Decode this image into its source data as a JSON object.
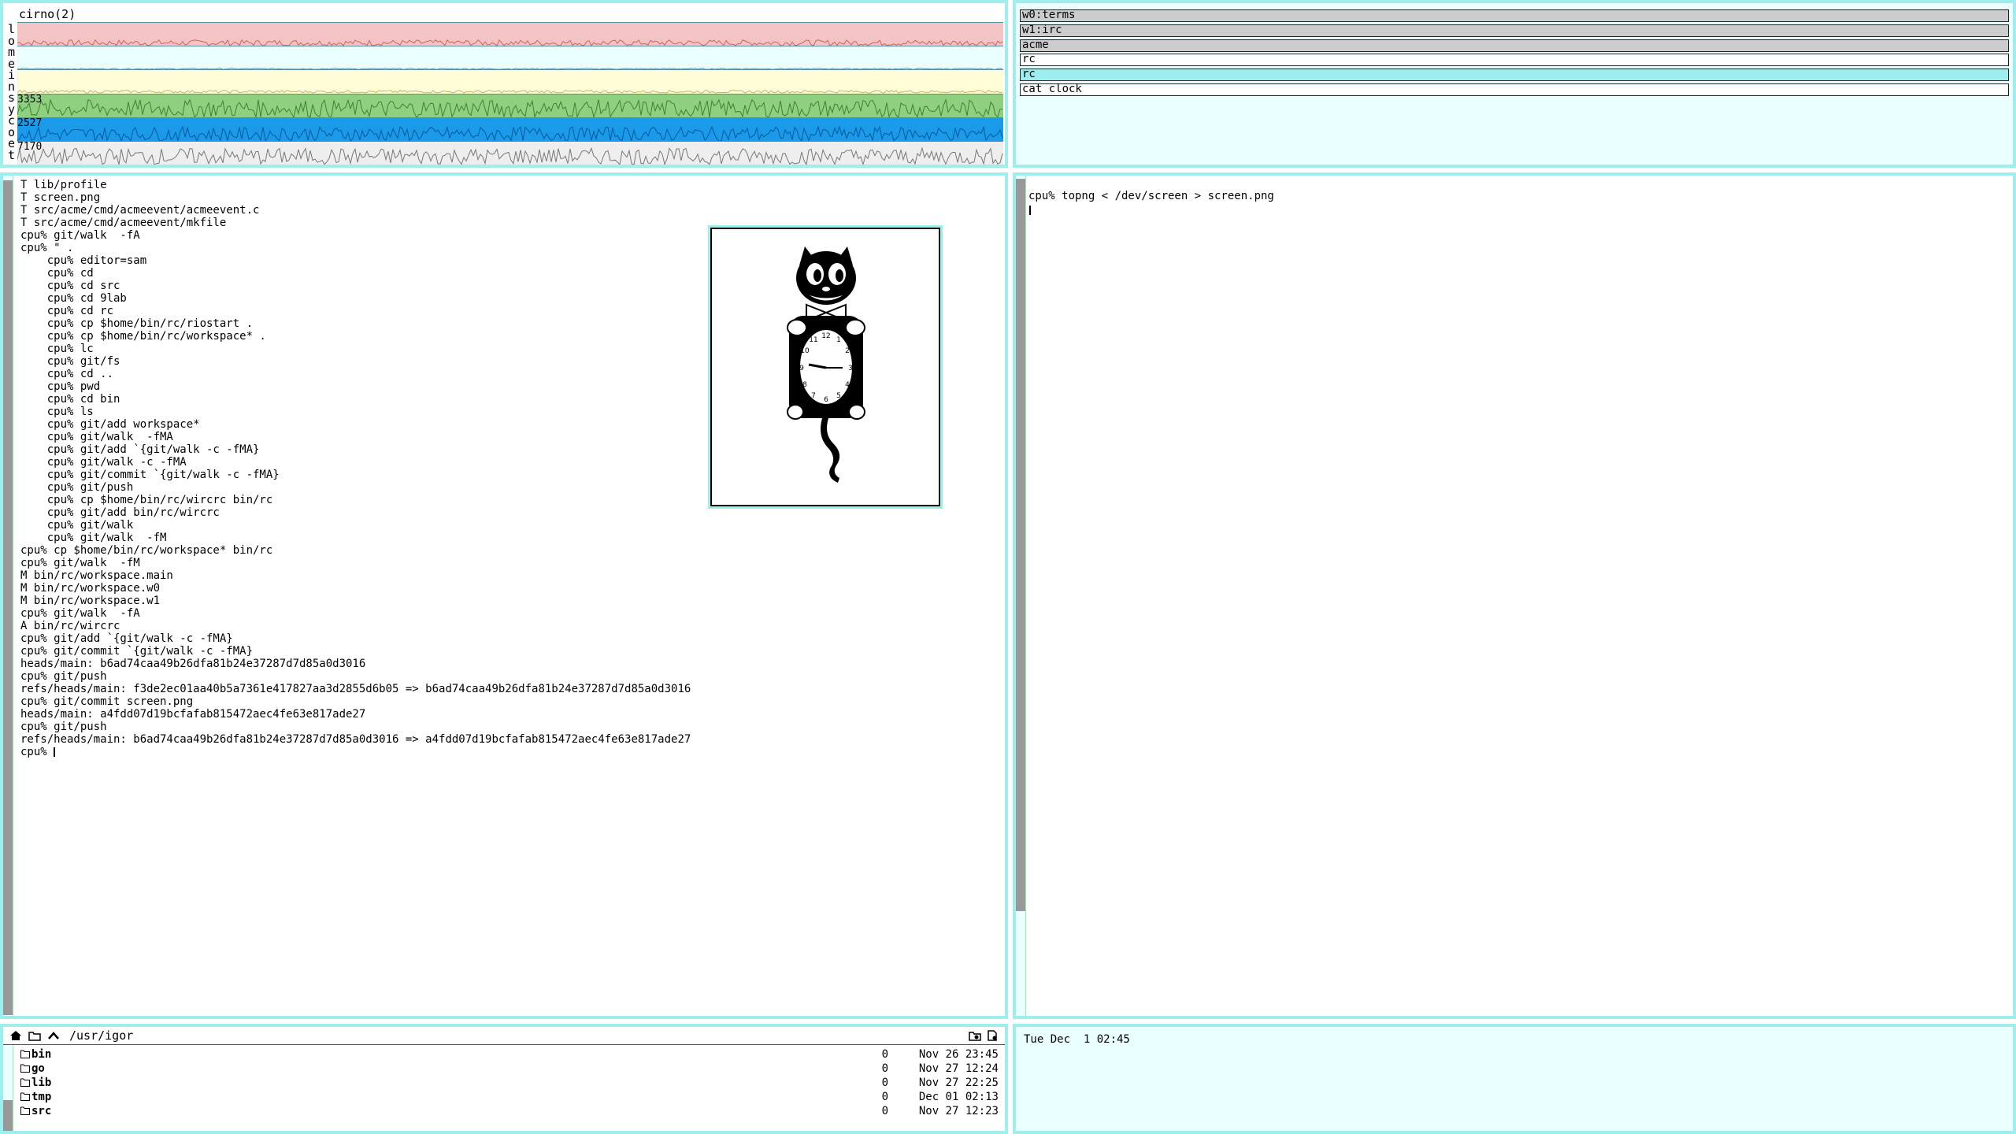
{
  "stats": {
    "title": "cirno(2)",
    "labels": [
      "l",
      "o",
      "m",
      "e",
      "i",
      "n",
      "s",
      "y",
      "c",
      "o",
      "e",
      "t"
    ],
    "graphs": [
      {
        "color": "#f4c4c4",
        "line": "#d06060",
        "value": ""
      },
      {
        "color": "#eaffff",
        "line": "#5a8ea0",
        "value": ""
      },
      {
        "color": "#fffcd8",
        "line": "#c0b860",
        "value": ""
      },
      {
        "color": "#8ed080",
        "line": "#408030",
        "value": "3353"
      },
      {
        "color": "#1a9ae8",
        "line": "#005a9c",
        "value": "2527"
      },
      {
        "color": "#eeeeee",
        "line": "#777777",
        "value": "7170"
      }
    ]
  },
  "windows": [
    "w0:terms",
    "w1:irc",
    "acme",
    "rc",
    "rc",
    "cat clock"
  ],
  "terminal_left": {
    "lines": [
      "T lib/profile",
      "T screen.png",
      "T src/acme/cmd/acmeevent/acmeevent.c",
      "T src/acme/cmd/acmeevent/mkfile",
      "cpu% git/walk  -fA",
      "cpu% \" .",
      "    cpu% editor=sam",
      "    cpu% cd",
      "    cpu% cd src",
      "    cpu% cd 9lab",
      "    cpu% cd rc",
      "    cpu% cp $home/bin/rc/riostart .",
      "    cpu% cp $home/bin/rc/workspace* .",
      "    cpu% lc",
      "    cpu% git/fs",
      "    cpu% cd ..",
      "    cpu% pwd",
      "    cpu% cd bin",
      "    cpu% ls",
      "    cpu% git/add workspace*",
      "    cpu% git/walk  -fMA",
      "    cpu% git/add `{git/walk -c -fMA}",
      "    cpu% git/walk -c -fMA",
      "    cpu% git/commit `{git/walk -c -fMA}",
      "    cpu% git/push",
      "    cpu% cp $home/bin/rc/wircrc bin/rc",
      "    cpu% git/add bin/rc/wircrc",
      "    cpu% git/walk",
      "    cpu% git/walk  -fM",
      "cpu% cp $home/bin/rc/workspace* bin/rc",
      "cpu% git/walk  -fM",
      "M bin/rc/workspace.main",
      "M bin/rc/workspace.w0",
      "M bin/rc/workspace.w1",
      "cpu% git/walk  -fA",
      "A bin/rc/wircrc",
      "cpu% git/add `{git/walk -c -fMA}",
      "cpu% git/commit `{git/walk -c -fMA}",
      "heads/main: b6ad74caa49b26dfa81b24e37287d7d85a0d3016",
      "cpu% git/push",
      "refs/heads/main: f3de2ec01aa40b5a7361e417827aa3d2855d6b05 => b6ad74caa49b26dfa81b24e37287d7d85a0d3016",
      "cpu% git/commit screen.png",
      "heads/main: a4fdd07d19bcfafab815472aec4fe63e817ade27",
      "cpu% git/push",
      "refs/heads/main: b6ad74caa49b26dfa81b24e37287d7d85a0d3016 => a4fdd07d19bcfafab815472aec4fe63e817ade27"
    ],
    "prompt": "cpu% "
  },
  "terminal_right": {
    "line": "cpu% topng < /dev/screen > screen.png"
  },
  "filebrowser": {
    "path": "/usr/igor",
    "icons": [
      "home-icon",
      "folder-icon",
      "up-icon",
      "new-folder-icon",
      "new-file-icon"
    ],
    "rows": [
      {
        "name": "bin",
        "size": "0",
        "date": "Nov 26 23:45"
      },
      {
        "name": "go",
        "size": "0",
        "date": "Nov 27 12:24"
      },
      {
        "name": "lib",
        "size": "0",
        "date": "Nov 27 22:25"
      },
      {
        "name": "tmp",
        "size": "0",
        "date": "Dec 01 02:13"
      },
      {
        "name": "src",
        "size": "0",
        "date": "Nov 27 12:23"
      }
    ]
  },
  "clock": {
    "text": "Tue Dec  1 02:45"
  }
}
